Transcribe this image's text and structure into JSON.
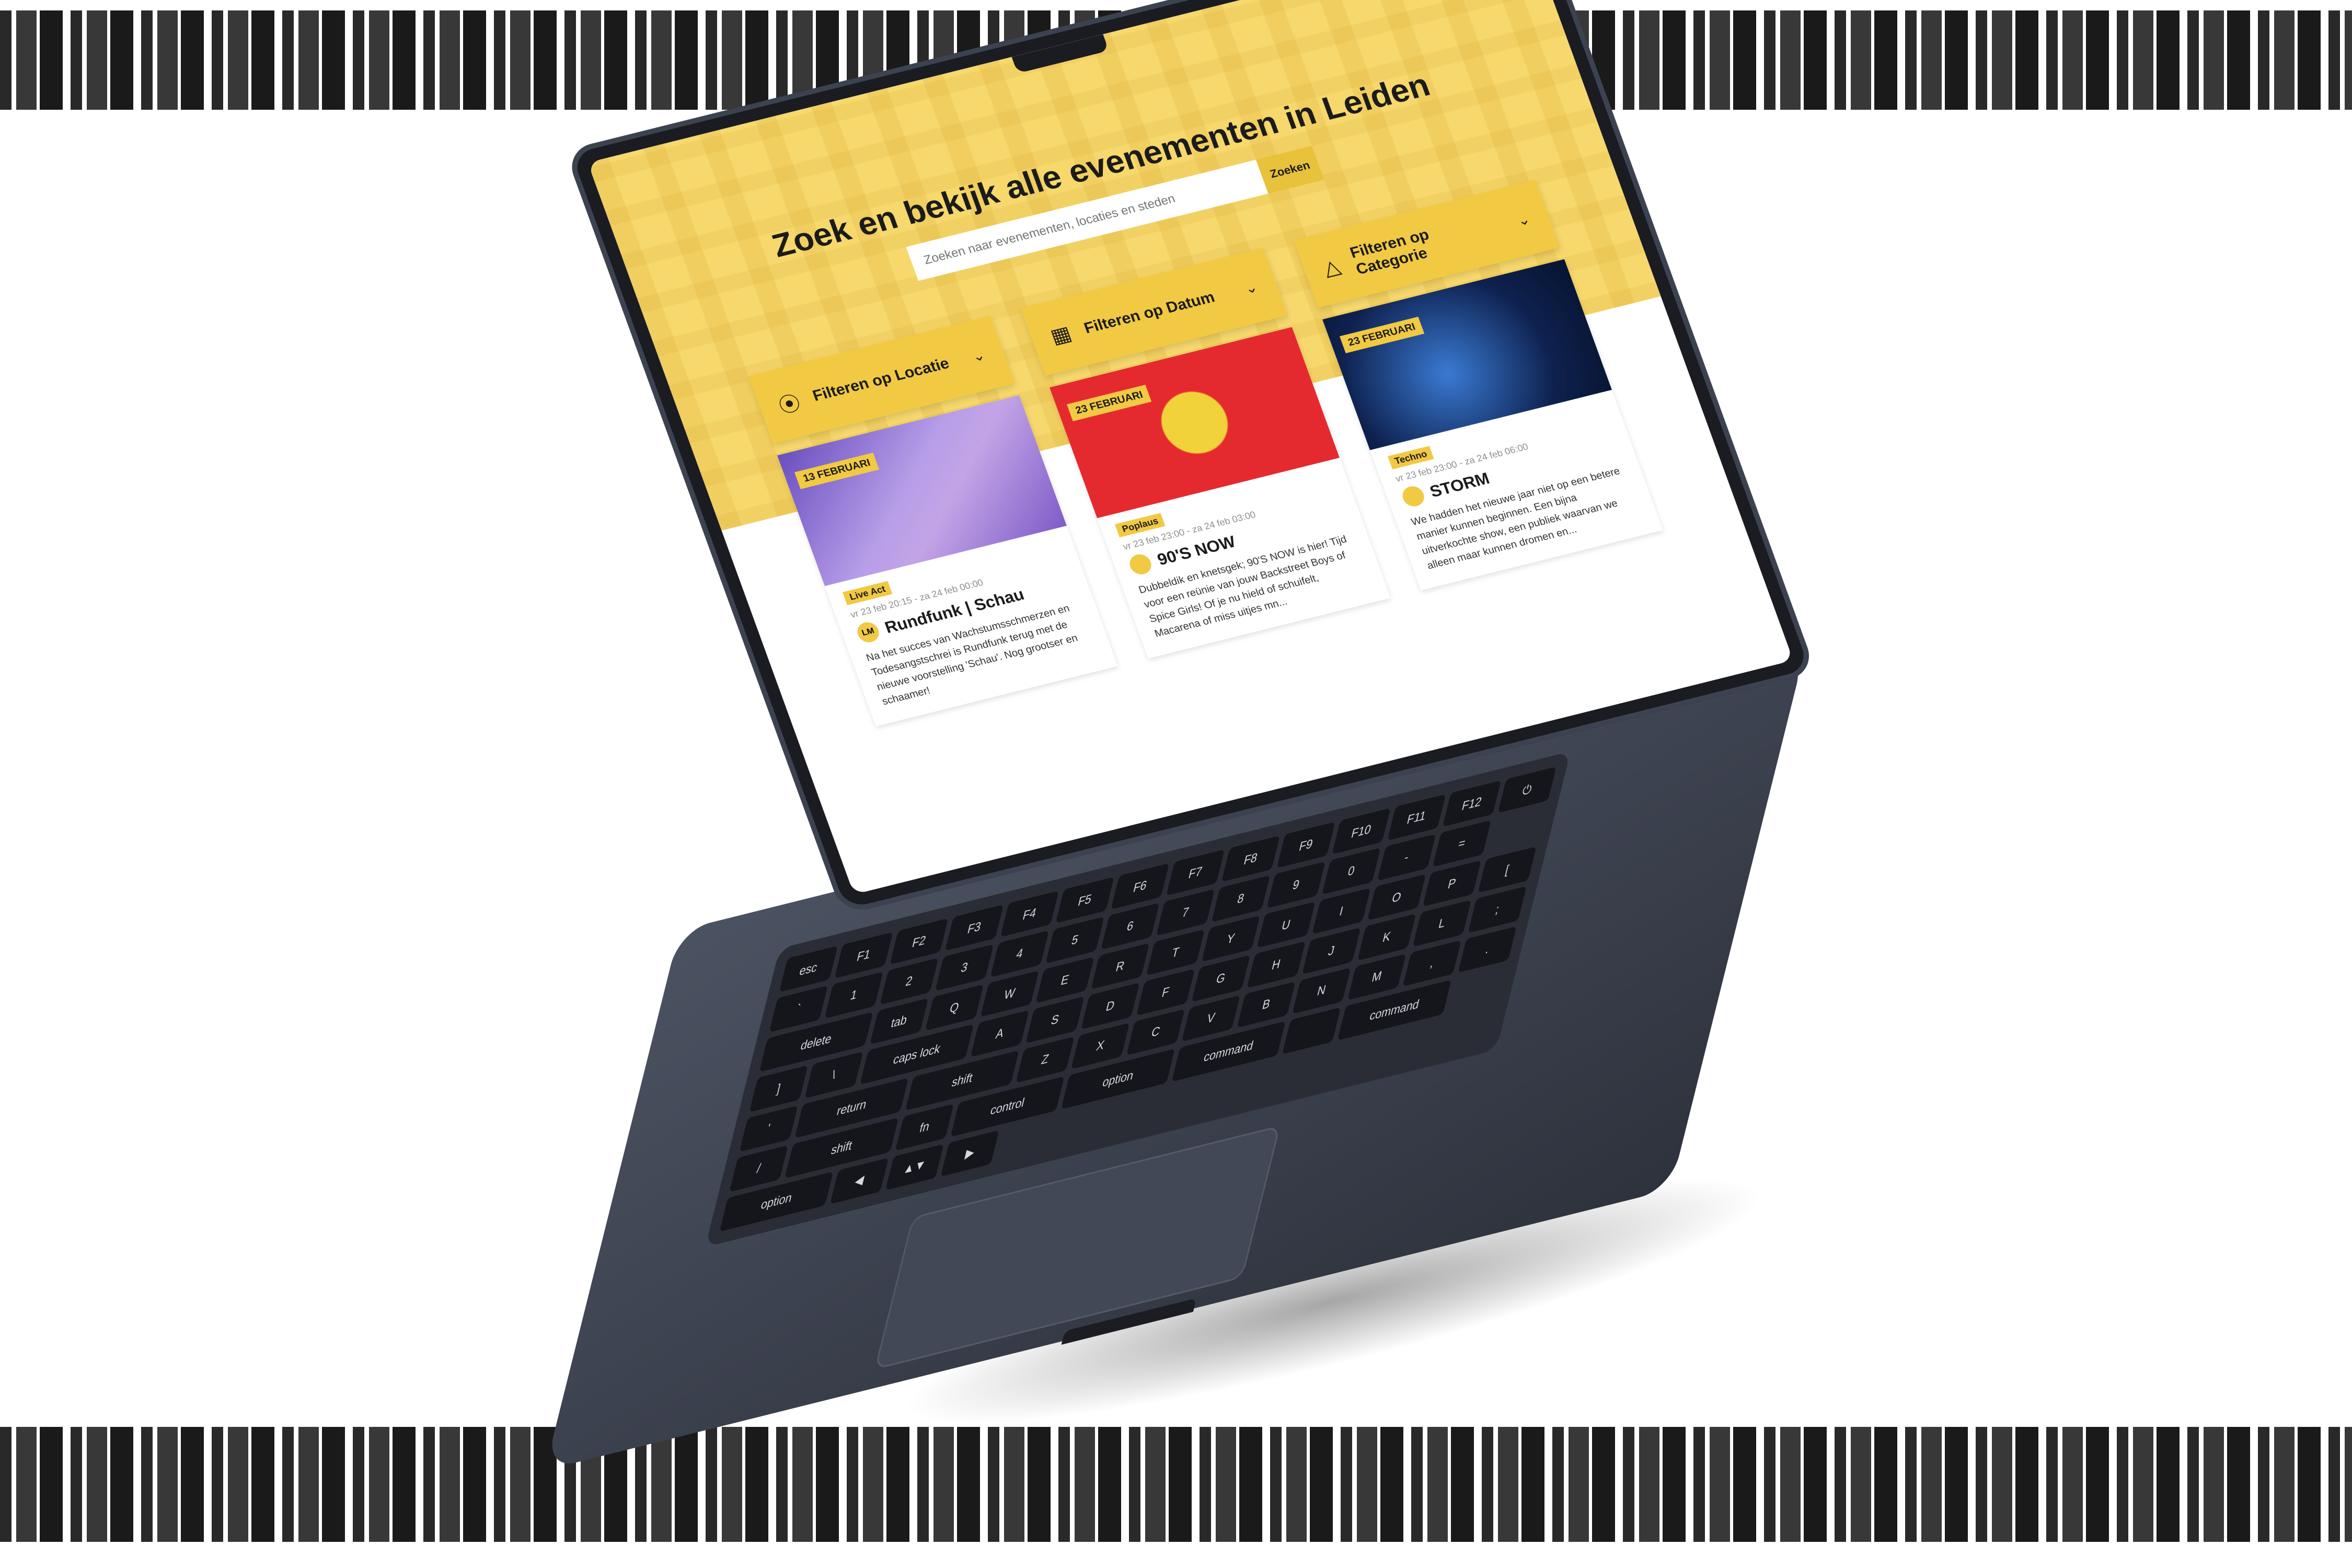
{
  "page": {
    "title": "Zoek en bekijk alle evenementen in Leiden"
  },
  "search": {
    "placeholder": "Zoeken naar evenementen, locaties en steden",
    "button_label": "Zoeken"
  },
  "filters": [
    {
      "label": "Filteren op Locatie",
      "icon": "location-pin-icon"
    },
    {
      "label": "Filteren op Datum",
      "icon": "calendar-icon"
    },
    {
      "label": "Filteren op Categorie",
      "icon": "shapes-icon"
    }
  ],
  "events": [
    {
      "date_badge": "13 FEBRUARI",
      "tag": "Live Act",
      "time": "vr 23 feb 20:15 - za 24 feb 00:00",
      "avatar": "LM",
      "title": "Rundfunk | Schau",
      "description": "Na het succes van Wachstumsschmerzen en Todesangstschrei is Rundfunk terug met de nieuwe voorstelling 'Schau'. Nog grootser en schaamer!"
    },
    {
      "date_badge": "23 FEBRUARI",
      "tag": "Poplaus",
      "time": "vr 23 feb 23:00 - za 24 feb 03:00",
      "avatar": "",
      "title": "90'S NOW",
      "description": "Dubbeldik en knetsgek; 90'S NOW is hier! Tijd voor een reünie van jouw Backstreet Boys of Spice Girls! Of je nu hield of schuifelt, Macarena of miss uitjes mn..."
    },
    {
      "date_badge": "23 FEBRUARI",
      "tag": "Techno",
      "time": "vr 23 feb 23:00 - za 24 feb 06:00",
      "avatar": "",
      "title": "STORM",
      "description": "We hadden het nieuwe jaar niet op een betere manier kunnen beginnen. Een bijna uitverkochte show, een publiek waarvan we alleen maar kunnen dromen en..."
    }
  ],
  "keyboard": {
    "rows": [
      [
        "esc",
        "F1",
        "F2",
        "F3",
        "F4",
        "F5",
        "F6",
        "F7",
        "F8",
        "F9",
        "F10",
        "F11",
        "F12",
        "⏻"
      ],
      [
        "`",
        "1",
        "2",
        "3",
        "4",
        "5",
        "6",
        "7",
        "8",
        "9",
        "0",
        "-",
        "=",
        "delete"
      ],
      [
        "tab",
        "Q",
        "W",
        "E",
        "R",
        "T",
        "Y",
        "U",
        "I",
        "O",
        "P",
        "[",
        "]",
        "\\"
      ],
      [
        "caps lock",
        "A",
        "S",
        "D",
        "F",
        "G",
        "H",
        "J",
        "K",
        "L",
        ";",
        "'",
        "return"
      ],
      [
        "shift",
        "Z",
        "X",
        "C",
        "V",
        "B",
        "N",
        "M",
        ",",
        ".",
        "/",
        "shift"
      ],
      [
        "fn",
        "control",
        "option",
        "command",
        "",
        "command",
        "option",
        "◀",
        "▲▼",
        "▶"
      ]
    ]
  }
}
